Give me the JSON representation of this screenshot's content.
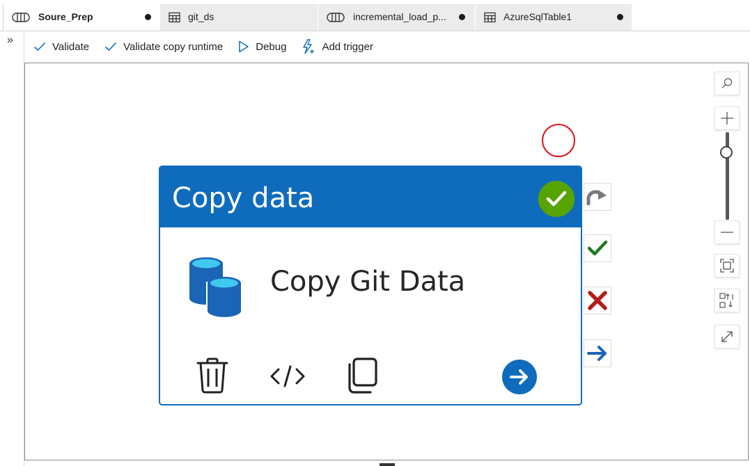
{
  "tabs": [
    {
      "label": "Soure_Prep",
      "icon": "pipeline-icon",
      "active": true,
      "unsaved": true
    },
    {
      "label": "git_ds",
      "icon": "table-icon",
      "active": false,
      "unsaved": false
    },
    {
      "label": "incremental_load_p...",
      "icon": "pipeline-icon",
      "active": false,
      "unsaved": true
    },
    {
      "label": "AzureSqlTable1",
      "icon": "table-icon",
      "active": false,
      "unsaved": true
    }
  ],
  "sidebar": {
    "expand_label": "»"
  },
  "toolbar": {
    "validate_label": "Validate",
    "validate_copy_runtime_label": "Validate copy runtime",
    "debug_label": "Debug",
    "add_trigger_label": "Add trigger"
  },
  "activity": {
    "type_label": "Copy data",
    "name": "Copy Git Data",
    "status": "succeeded"
  },
  "colors": {
    "accent": "#0f6cbd",
    "success": "#57a300",
    "failure": "#c50f1f",
    "annotation": "#e0141e"
  }
}
